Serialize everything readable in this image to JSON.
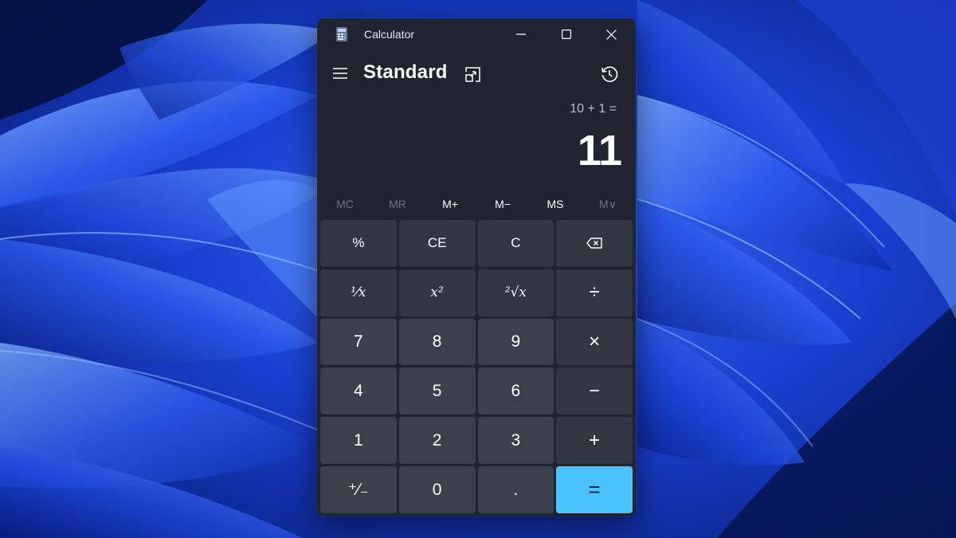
{
  "window": {
    "title": "Calculator",
    "icon": "calculator-icon"
  },
  "header": {
    "mode": "Standard",
    "menu_icon": "hamburger-menu-icon",
    "keep_on_top_icon": "keep-on-top-icon",
    "history_icon": "history-icon"
  },
  "display": {
    "expression": "10 + 1 =",
    "result": "11"
  },
  "memory": [
    {
      "label": "MC",
      "enabled": false
    },
    {
      "label": "MR",
      "enabled": false
    },
    {
      "label": "M+",
      "enabled": true
    },
    {
      "label": "M−",
      "enabled": true
    },
    {
      "label": "MS",
      "enabled": true
    },
    {
      "label": "M∨",
      "enabled": false
    }
  ],
  "keys": {
    "percent": "%",
    "ce": "CE",
    "clear": "C",
    "backspace": "backspace-icon",
    "reciprocal": "¹⁄x",
    "square": "x²",
    "sqrt": "²√x",
    "divide": "÷",
    "seven": "7",
    "eight": "8",
    "nine": "9",
    "multiply": "×",
    "four": "4",
    "five": "5",
    "six": "6",
    "minus": "−",
    "one": "1",
    "two": "2",
    "three": "3",
    "plus": "+",
    "negate": "⁺⁄₋",
    "zero": "0",
    "decimal": ".",
    "equals": "="
  },
  "colors": {
    "accent": "#4cc2ff",
    "window_bg": "#202531",
    "number_key": "#3b404d",
    "function_key": "#323744"
  }
}
